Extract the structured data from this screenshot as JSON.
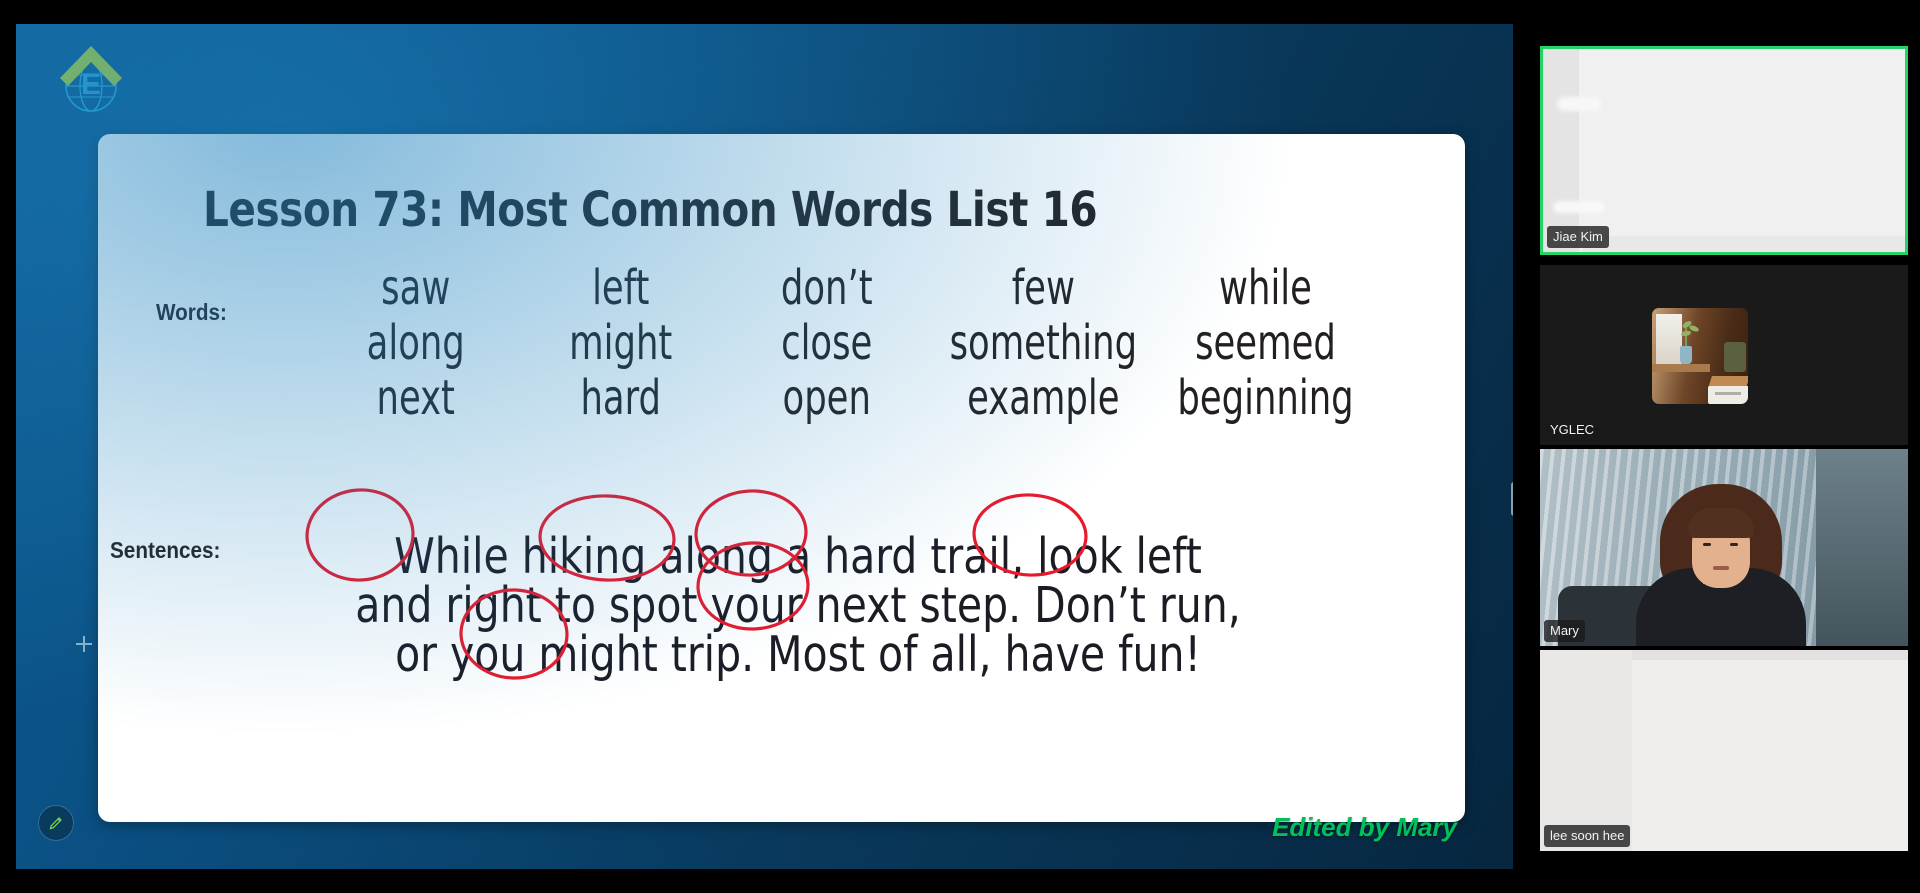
{
  "share": {
    "logo_name": "yglec-logo",
    "edited_by": "Edited by Mary"
  },
  "slide": {
    "title": "Lesson 73: Most Common Words List 16",
    "words_label": "Words:",
    "sentences_label": "Sentences:",
    "words": [
      "saw",
      "left",
      "don’t",
      "few",
      "while",
      "along",
      "might",
      "close",
      "something",
      "seemed",
      "next",
      "hard",
      "open",
      "example",
      "beginning"
    ],
    "sentences": [
      "While hiking along a hard trail, look left",
      "and right to spot your next step. Don’t run,",
      "or you might trip. Most of all, have fun!"
    ],
    "circled_words": [
      "While",
      "along",
      "hard",
      "left",
      "next",
      "might"
    ],
    "annotation_color": "#e8192c"
  },
  "participants": [
    {
      "name": "Jiae Kim",
      "active_speaker": true
    },
    {
      "name": "YGLEC",
      "active_speaker": false
    },
    {
      "name": "Mary",
      "active_speaker": false
    },
    {
      "name": "lee soon hee",
      "active_speaker": false
    }
  ],
  "controls": {
    "pen_icon": "pen-icon",
    "crosshair_icon": "crosshair-icon",
    "resize_handle": "panel-resize-handle"
  },
  "colors": {
    "active_speaker_border": "#25d366",
    "stage_blue": "#0a4f82",
    "edited_green": "#00c05a"
  }
}
